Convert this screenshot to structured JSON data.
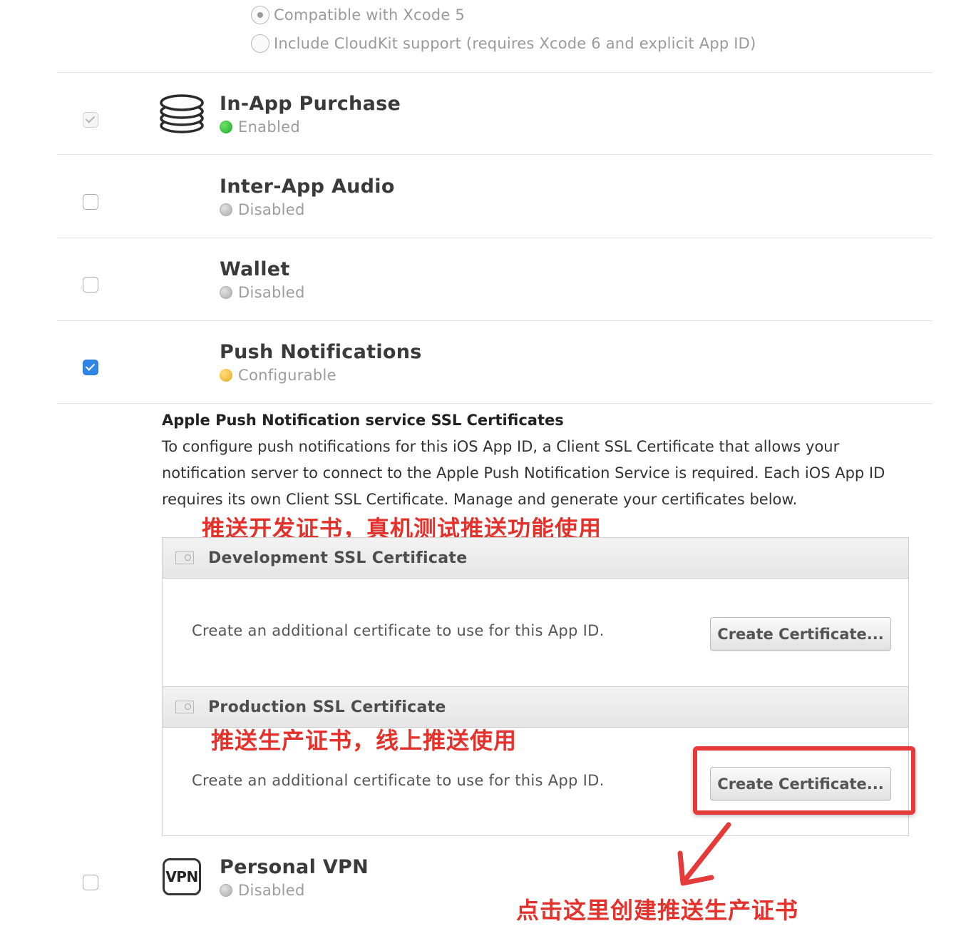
{
  "icloud_options": [
    {
      "label": "Compatible with Xcode 5",
      "selected": true
    },
    {
      "label": "Include CloudKit support (requires Xcode 6 and explicit App ID)",
      "selected": false
    }
  ],
  "services": [
    {
      "name": "In-App Purchase",
      "status": "Enabled",
      "status_color": "#1fa62a",
      "checked": true,
      "icon": "coin-stack-icon"
    },
    {
      "name": "Inter-App Audio",
      "status": "Disabled",
      "status_color": "#a9a9a9",
      "checked": false
    },
    {
      "name": "Wallet",
      "status": "Disabled",
      "status_color": "#a9a9a9",
      "checked": false
    },
    {
      "name": "Push Notifications",
      "status": "Configurable",
      "status_color": "#e6a81e",
      "checked": true
    },
    {
      "name": "Personal VPN",
      "status": "Disabled",
      "status_color": "#a9a9a9",
      "checked": false,
      "icon": "vpn-icon",
      "icon_text": "VPN"
    }
  ],
  "apns": {
    "title": "Apple Push Notification service SSL Certificates",
    "description": "To configure push notifications for this iOS App ID, a Client SSL Certificate that allows your notification server to connect to the Apple Push Notification Service is required. Each iOS App ID requires its own Client SSL Certificate. Manage and generate your certificates below."
  },
  "development": {
    "header": "Development SSL Certificate",
    "text": "Create an additional certificate to use for this App ID.",
    "button": "Create Certificate..."
  },
  "production": {
    "header": "Production SSL Certificate",
    "text": "Create an additional certificate to use for this App ID.",
    "button": "Create Certificate..."
  },
  "annotations": {
    "dev_note": "推送开发证书，真机测试推送功能使用",
    "prod_note": "推送生产证书，线上推送使用",
    "click_note": "点击这里创建推送生产证书",
    "color": "#e4312b"
  }
}
